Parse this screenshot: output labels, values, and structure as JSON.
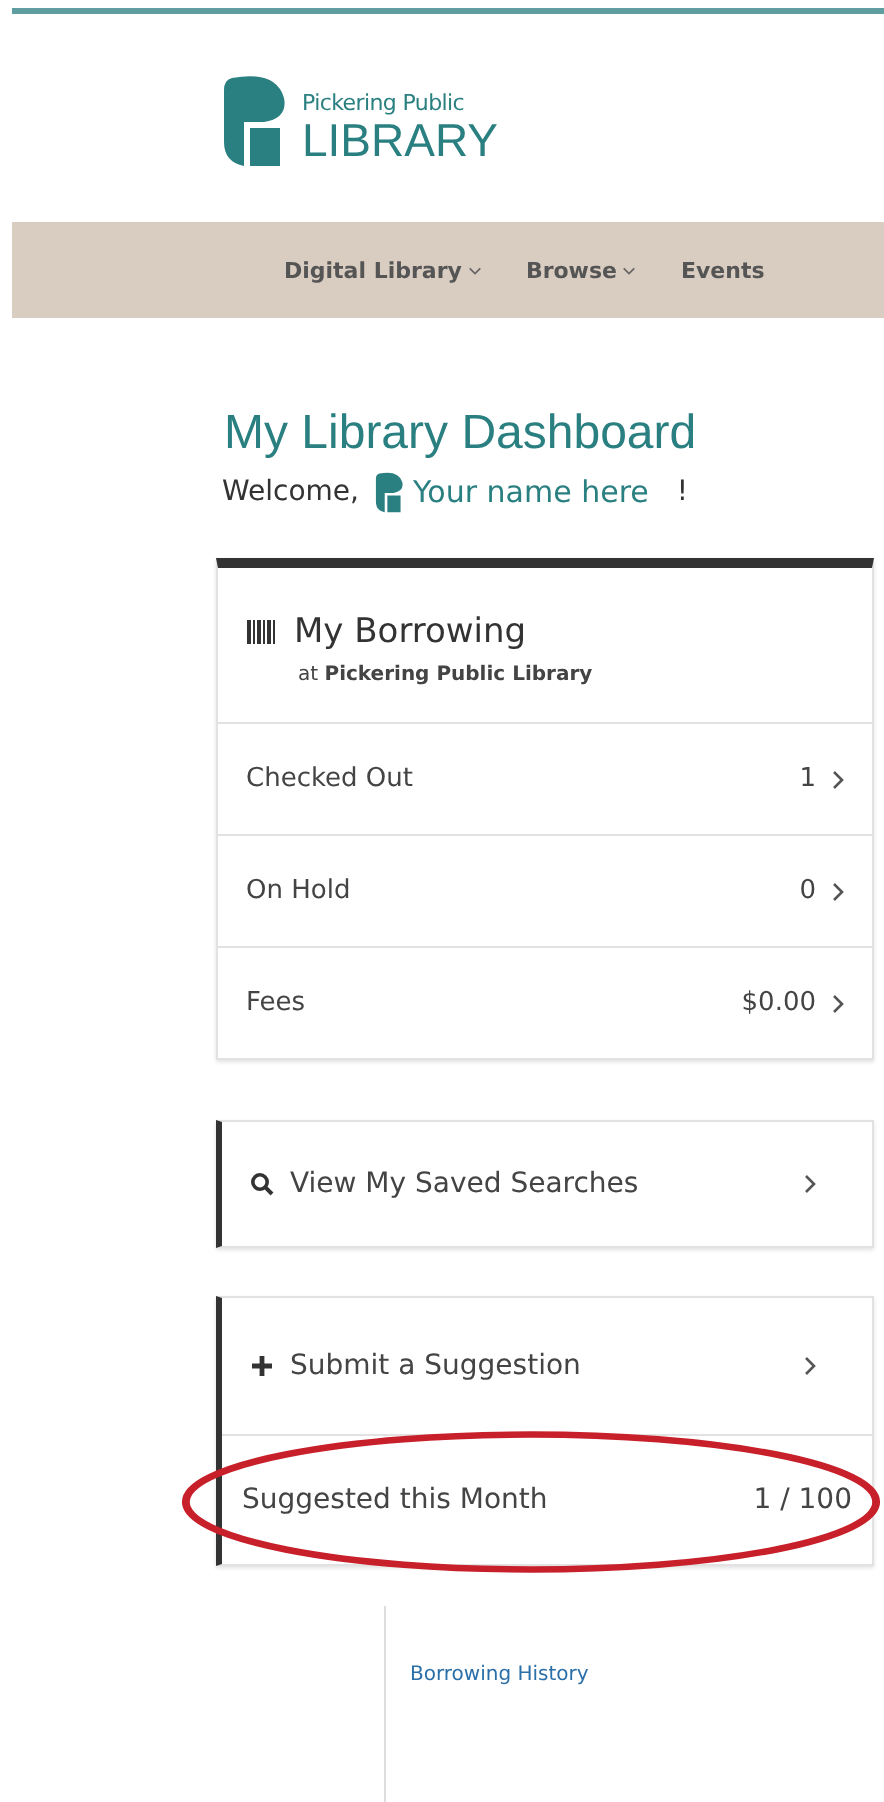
{
  "logo": {
    "line1": "Pickering Public",
    "line2": "LIBRARY"
  },
  "nav": [
    {
      "label": "Digital Library",
      "dropdown": true
    },
    {
      "label": "Browse",
      "dropdown": true
    },
    {
      "label": "Events",
      "dropdown": false
    }
  ],
  "dashboard": {
    "title": "My Library Dashboard",
    "welcome": "Welcome,",
    "user": "Your name here",
    "exclaim": "!"
  },
  "borrowing": {
    "title": "My Borrowing",
    "subtitle": "at **Pickering Public Library**",
    "rows": [
      {
        "label": "Checked Out",
        "value": "1"
      },
      {
        "label": "On Hold",
        "value": "0"
      },
      {
        "label": "Fees",
        "value": "$0.00"
      }
    ]
  },
  "saved_searches": {
    "label": "View My Saved Searches"
  },
  "suggestion": {
    "label": "Submit a Suggestion",
    "count_label": "Suggested this Month",
    "count": "1 / 100",
    "highlighted": true
  },
  "side_menu": {
    "items": [
      "Borrowing History"
    ]
  }
}
